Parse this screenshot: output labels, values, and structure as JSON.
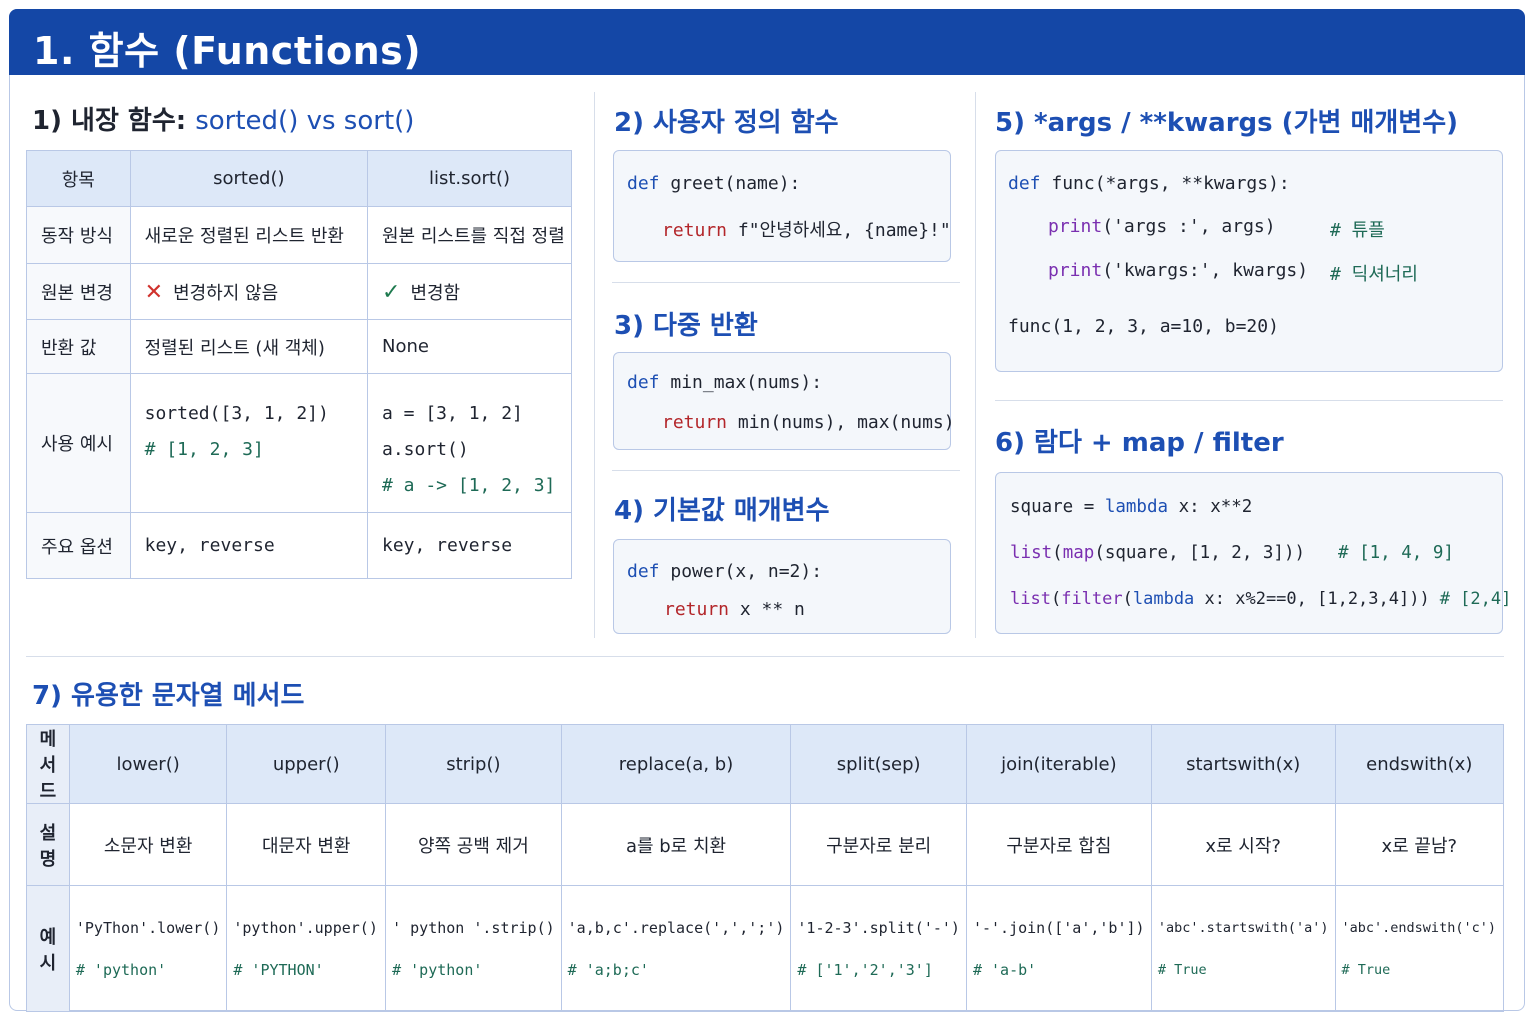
{
  "header": {
    "title": "1. 함수 (Functions)"
  },
  "s1": {
    "title_prefix": "1) 내장 함수:",
    "title_code": "sorted() vs sort()",
    "headers": [
      "항목",
      "sorted()",
      "list.sort()"
    ],
    "rows": [
      {
        "label": "동작 방식",
        "a": "새로운 정렬된 리스트 반환",
        "b": "원본 리스트를 직접 정렬"
      },
      {
        "label": "원본 변경",
        "a": "변경하지 않음",
        "b": "변경함"
      },
      {
        "label": "반환 값",
        "a": "정렬된 리스트 (새 객체)",
        "b": "None"
      },
      {
        "label": "사용 예시",
        "a1": "sorted([3, 1, 2])",
        "a2": "# [1, 2, 3]",
        "b1": "a = [3, 1, 2]",
        "b2": "a.sort()",
        "b3": "# a -> [1, 2, 3]"
      },
      {
        "label": "주요 옵션",
        "a": "key, reverse",
        "b": "key, reverse"
      }
    ],
    "icons": {
      "no": "x-mark-icon",
      "yes": "check-mark-icon"
    }
  },
  "s2": {
    "title": "2) 사용자 정의 함수",
    "l1_kw": "def",
    "l1_rest": " greet(name):",
    "l2_kw": "return",
    "l2_rest": " f\"안녕하세요, {name}!\""
  },
  "s3": {
    "title": "3) 다중 반환",
    "l1_kw": "def",
    "l1_rest": " min_max(nums):",
    "l2_kw": "return",
    "l2_rest": " min(nums), max(nums)"
  },
  "s4": {
    "title": "4) 기본값 매개변수",
    "l1_kw": "def",
    "l1_rest": " power(x, n=2):",
    "l2_kw": "return",
    "l2_rest": " x ** n"
  },
  "s5": {
    "title": "5) *args / **kwargs (가변 매개변수)",
    "l1_kw": "def",
    "l1_rest": " func(*args, **kwargs):",
    "l2_fn": "print",
    "l2_rest": "('args :', args)",
    "l2_cm": "# 튜플",
    "l3_fn": "print",
    "l3_rest": "('kwargs:', kwargs)",
    "l3_cm": "# 딕셔너리",
    "l4": "func(1, 2, 3, a=10, b=20)"
  },
  "s6": {
    "title": "6) 람다 + map / filter",
    "l1_a": "square = ",
    "l1_kw": "lambda",
    "l1_b": " x: x**2",
    "l2_f1": "list",
    "l2_p1": "(",
    "l2_f2": "map",
    "l2_rest": "(square, [1, 2, 3]))",
    "l2_cm": "# [1, 4, 9]",
    "l3_f1": "list",
    "l3_p1": "(",
    "l3_f2": "filter",
    "l3_p2": "(",
    "l3_kw": "lambda",
    "l3_rest": " x: x%2==0, [1,2,3,4]))",
    "l3_cm": "# [2,4]"
  },
  "s7": {
    "title": "7) 유용한 문자열 메서드",
    "row_labels": [
      "메서드",
      "설명",
      "예시"
    ],
    "methods": [
      {
        "name": "lower()",
        "desc": "소문자 변환",
        "ex1": "'PyThon'.lower()",
        "ex2": "# 'python'"
      },
      {
        "name": "upper()",
        "desc": "대문자 변환",
        "ex1": "'python'.upper()",
        "ex2": "# 'PYTHON'"
      },
      {
        "name": "strip()",
        "desc": "양쪽 공백 제거",
        "ex1": "' python '.strip()",
        "ex2": "# 'python'"
      },
      {
        "name": "replace(a, b)",
        "desc": "a를 b로 치환",
        "ex1": "'a,b,c'.replace(',',';')",
        "ex2": "# 'a;b;c'"
      },
      {
        "name": "split(sep)",
        "desc": "구분자로 분리",
        "ex1": "'1-2-3'.split('-')",
        "ex2": "# ['1','2','3']"
      },
      {
        "name": "join(iterable)",
        "desc": "구분자로 합침",
        "ex1": "'-'.join(['a','b'])",
        "ex2": "# 'a-b'"
      },
      {
        "name": "startswith(x)",
        "desc": "x로 시작?",
        "ex1": "'abc'.startswith('a')",
        "ex2": "# True"
      },
      {
        "name": "endswith(x)",
        "desc": "x로 끝남?",
        "ex1": "'abc'.endswith('c')",
        "ex2": "# True"
      }
    ]
  }
}
